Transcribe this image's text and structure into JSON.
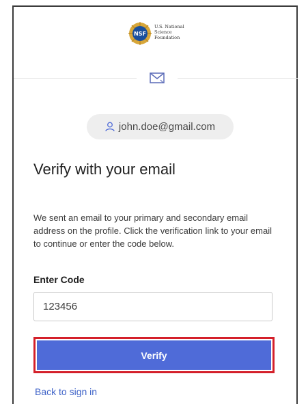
{
  "logo": {
    "lines": [
      "U.S. National",
      "Science",
      "Foundation"
    ],
    "seal_label": "NSF",
    "seal_color": "#1a4f9c",
    "ring_color": "#d8a73a"
  },
  "account": {
    "email": "john.doe@gmail.com"
  },
  "page": {
    "title": "Verify with your email",
    "instructions": "We sent an email to your primary and secondary email address on the profile. Click the verification link to your email to continue or enter the code below."
  },
  "form": {
    "code_label": "Enter Code",
    "code_value": "123456",
    "verify_label": "Verify",
    "back_label": "Back to sign in"
  },
  "colors": {
    "accent": "#4f6bd8",
    "highlight": "#d4202a",
    "link": "#3f63c8"
  },
  "icons": [
    "mail-icon",
    "user-icon"
  ]
}
